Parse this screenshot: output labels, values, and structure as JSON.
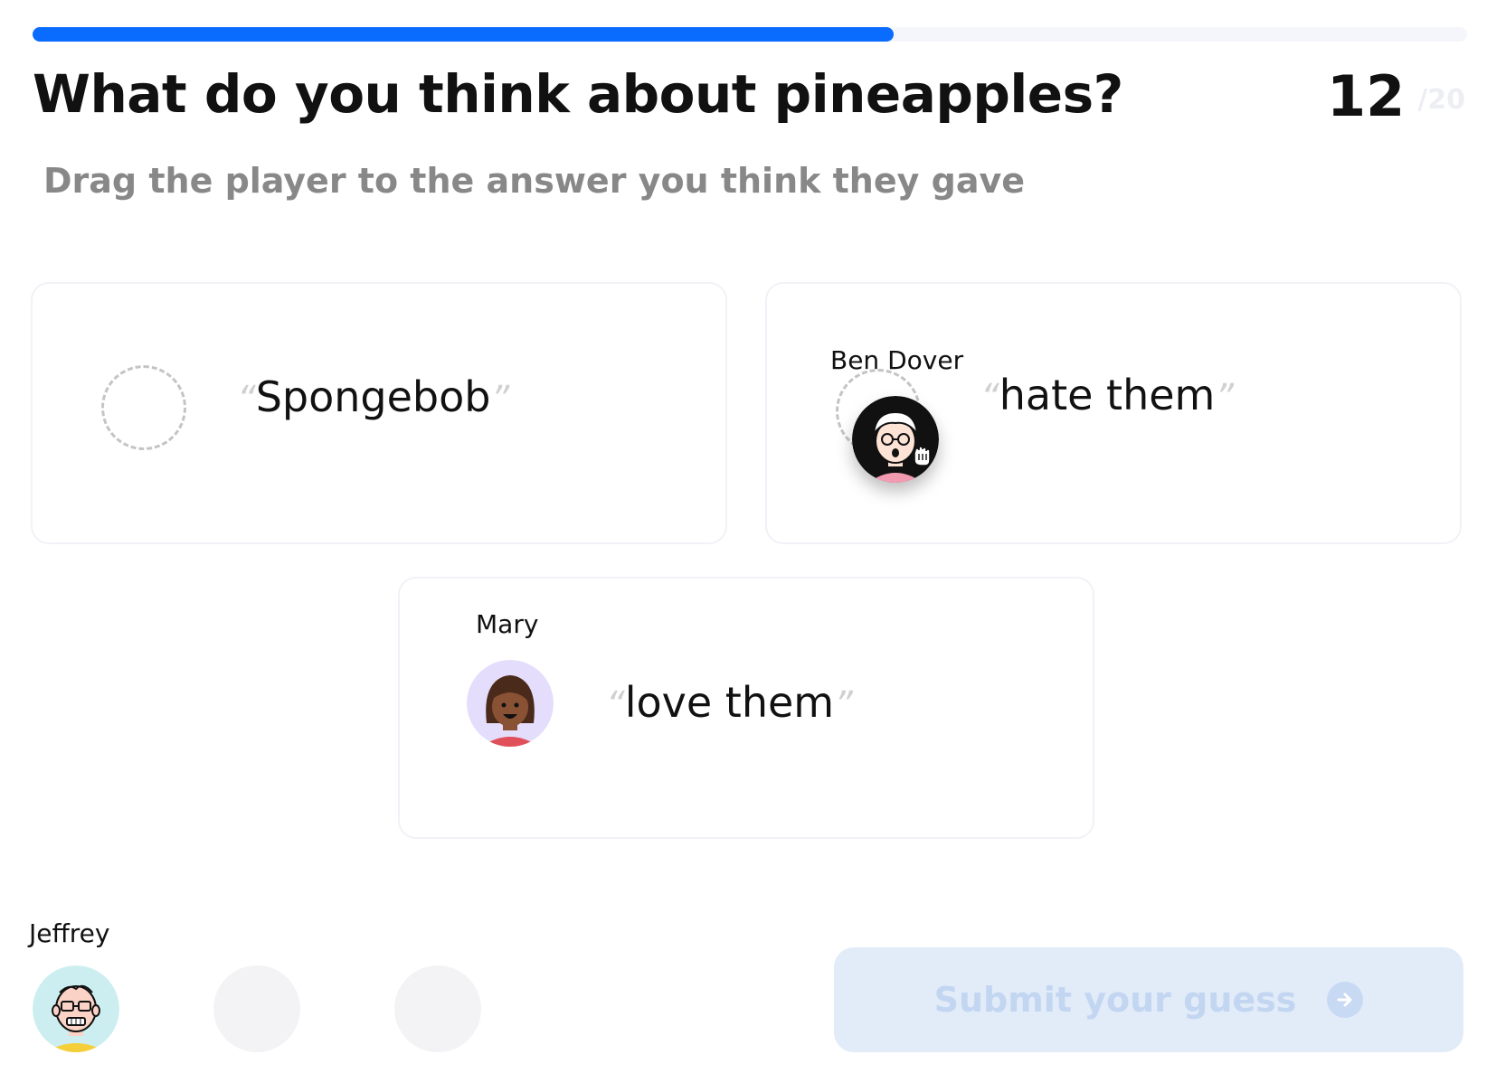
{
  "progress": {
    "value": 0.6,
    "color": "#0a6cff"
  },
  "question": {
    "title": "What do you think about pineapples?",
    "subtitle": "Drag the player to the answer you think they gave",
    "current": "12",
    "total": "/20"
  },
  "quote_open": "“",
  "quote_close": "”",
  "answers": [
    {
      "text": "Spongebob",
      "player": null
    },
    {
      "text": "hate them",
      "player": "Ben Dover"
    },
    {
      "text": "love them",
      "player": "Mary"
    }
  ],
  "tray": {
    "players": [
      {
        "name": "Jeffrey",
        "avatar": "jeffrey-avatar"
      }
    ],
    "empty_slots": 2
  },
  "submit": {
    "label": "Submit your guess",
    "icon": "arrow-right-circle-icon",
    "disabled": true
  }
}
